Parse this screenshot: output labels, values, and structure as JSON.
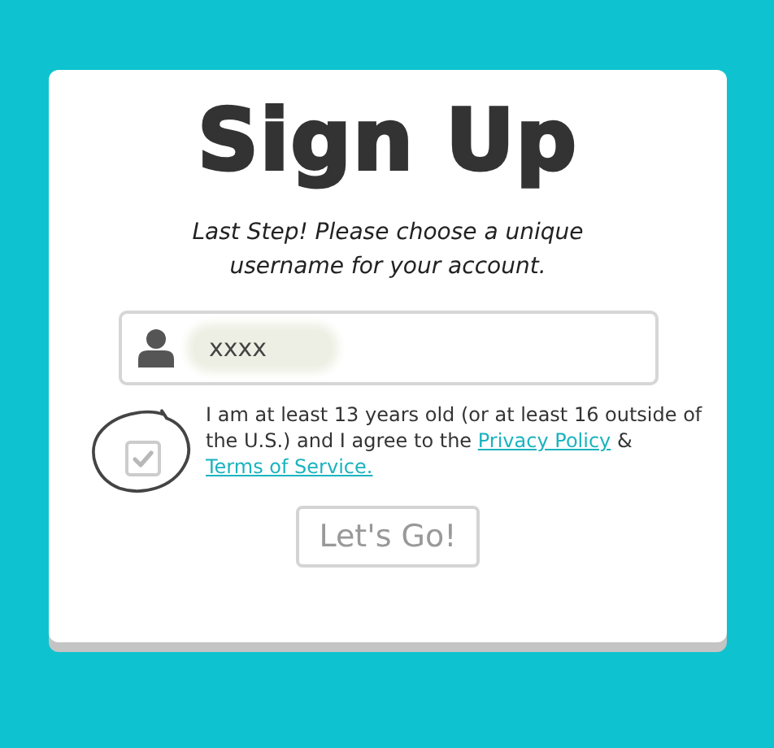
{
  "title": "Sign Up",
  "subtitle": "Last Step! Please choose a unique username for your account.",
  "username": {
    "value": "xxxx",
    "redacted": true
  },
  "consent": {
    "checked": true,
    "disabled": true,
    "text": "I am at least 13 years old (or at least 16 outside of the U.S.) and I agree to the",
    "links": [
      "Privacy Policy",
      "Terms of Service."
    ],
    "joiner": "&"
  },
  "submit": {
    "label": "Let's Go!",
    "disabled": true
  },
  "annotation": {
    "kind": "circle"
  }
}
